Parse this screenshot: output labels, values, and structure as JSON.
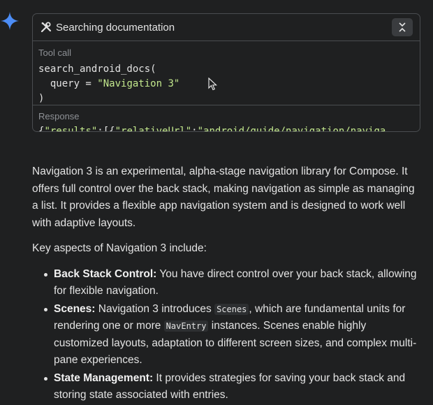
{
  "tool_card": {
    "title": "Searching documentation",
    "tool_call_label": "Tool call",
    "code_line1": "search_android_docs(",
    "code_line2_prefix": "  query = ",
    "code_line2_string": "\"Navigation 3\"",
    "code_line3": ")",
    "response_label": "Response",
    "response_prefix": "{",
    "response_k1": "\"results\"",
    "response_mid": ":[{",
    "response_k2": "\"relativeUrl\"",
    "response_colon": ":",
    "response_v2": "\"android/guide/navigation/naviga"
  },
  "answer": {
    "intro": "Navigation 3 is an experimental, alpha-stage navigation library for Compose. It offers full control over the back stack, making navigation as simple as managing a list. It provides a flexible app navigation system and is designed to work well with adaptive layouts.",
    "aspects_heading": "Key aspects of Navigation 3 include:",
    "item1_title": "Back Stack Control:",
    "item1_text": " You have direct control over your back stack, allowing for flexible navigation.",
    "item2_title": "Scenes:",
    "item2_text_a": " Navigation 3 introduces ",
    "item2_code_a": "Scenes",
    "item2_text_b": ", which are fundamental units for rendering one or more ",
    "item2_code_b": "NavEntry",
    "item2_text_c": " instances. Scenes enable highly customized layouts, adaptation to different screen sizes, and complex multi-pane experiences.",
    "item3_title": "State Management:",
    "item3_text": " It provides strategies for saving your back stack and storing state associated with entries."
  },
  "colors": {
    "accent_sparkle": "#4c8df6",
    "string_green": "#c3e88d",
    "border": "#4a4d50"
  },
  "icons": [
    "sparkle-icon",
    "tools-icon",
    "collapse-icon",
    "mouse-cursor-icon"
  ]
}
